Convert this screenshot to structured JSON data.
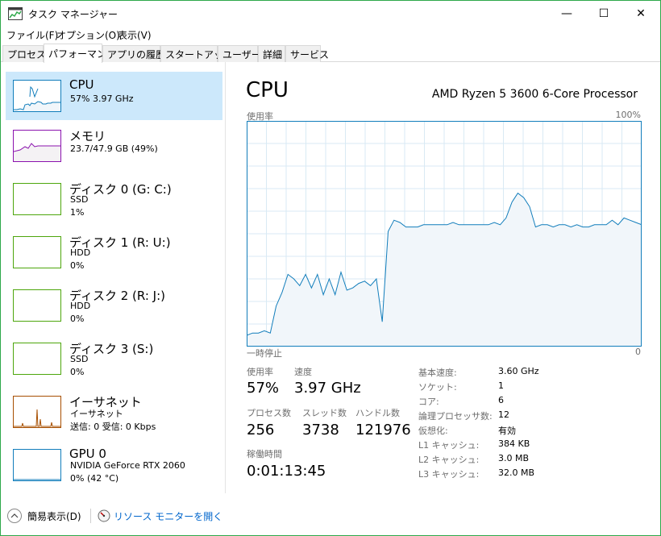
{
  "window": {
    "title": "タスク マネージャー",
    "minimize": "—",
    "maximize": "☐",
    "close": "✕"
  },
  "menu": [
    "ファイル(F)",
    "オプション(O)",
    "表示(V)"
  ],
  "tabs": [
    "プロセス",
    "パフォーマンス",
    "アプリの履歴",
    "スタートアップ",
    "ユーザー",
    "詳細",
    "サービス"
  ],
  "active_tab": "パフォーマンス",
  "devices": [
    {
      "title": "CPU",
      "lines": [
        "57%  3.97 GHz"
      ],
      "color": "#117dbb",
      "fill": "#f1f6fa",
      "selected": true
    },
    {
      "title": "メモリ",
      "lines": [
        "23.7/47.9 GB (49%)"
      ],
      "color": "#8b12ae",
      "fill": "#f4f2f4",
      "selected": false
    },
    {
      "title": "ディスク 0 (G: C:)",
      "lines": [
        "SSD",
        "1%"
      ],
      "color": "#4da60c",
      "fill": "#ffffff",
      "selected": false
    },
    {
      "title": "ディスク 1 (R: U:)",
      "lines": [
        "HDD",
        "0%"
      ],
      "color": "#4da60c",
      "fill": "#ffffff",
      "selected": false
    },
    {
      "title": "ディスク 2 (R: J:)",
      "lines": [
        "HDD",
        "0%"
      ],
      "color": "#4da60c",
      "fill": "#ffffff",
      "selected": false
    },
    {
      "title": "ディスク 3 (S:)",
      "lines": [
        "SSD",
        "0%"
      ],
      "color": "#4da60c",
      "fill": "#ffffff",
      "selected": false
    },
    {
      "title": "イーサネット",
      "lines": [
        "イーサネット",
        "送信: 0  受信: 0 Kbps"
      ],
      "color": "#a74f01",
      "fill": "#fcf3eb",
      "selected": false
    },
    {
      "title": "GPU 0",
      "lines": [
        "NVIDIA GeForce RTX 2060",
        "0%  (42 °C)"
      ],
      "color": "#117dbb",
      "fill": "#f1f6fa",
      "selected": false
    }
  ],
  "cpu": {
    "heading": "CPU",
    "model": "AMD Ryzen 5 3600 6-Core Processor",
    "graph_label": "使用率",
    "graph_max": "100%",
    "time_label": "一時停止",
    "time_zero": "0",
    "usage_label": "使用率",
    "usage_value": "57%",
    "speed_label": "速度",
    "speed_value": "3.97 GHz",
    "processes_label": "プロセス数",
    "processes_value": "256",
    "threads_label": "スレッド数",
    "threads_value": "3738",
    "handles_label": "ハンドル数",
    "handles_value": "121976",
    "uptime_label": "稼働時間",
    "uptime_value": "0:01:13:45",
    "specs": [
      {
        "k": "基本速度:",
        "v": "3.60 GHz"
      },
      {
        "k": "ソケット:",
        "v": "1"
      },
      {
        "k": "コア:",
        "v": "6"
      },
      {
        "k": "論理プロセッサ数:",
        "v": "12"
      },
      {
        "k": "仮想化:",
        "v": "有効"
      },
      {
        "k": "L1 キャッシュ:",
        "v": "384 KB"
      },
      {
        "k": "L2 キャッシュ:",
        "v": "3.0 MB"
      },
      {
        "k": "L3 キャッシュ:",
        "v": "32.0 MB"
      }
    ],
    "history": [
      5,
      6,
      6,
      7,
      6,
      18,
      24,
      32,
      30,
      27,
      32,
      26,
      32,
      23,
      30,
      23,
      33,
      25,
      26,
      28,
      29,
      27,
      30,
      11,
      51,
      56,
      55,
      53,
      53,
      53,
      54,
      54,
      54,
      54,
      54,
      55,
      54,
      54,
      54,
      54,
      54,
      54,
      55,
      54,
      57,
      64,
      68,
      66,
      62,
      53,
      54,
      54,
      53,
      54,
      54,
      53,
      54,
      53,
      53,
      54,
      54,
      54,
      56,
      54,
      57,
      56,
      55,
      54
    ]
  },
  "colors": {
    "accent": "#117dbb",
    "graph_fill": "#f1f6fa",
    "grid": "#d9eaf4",
    "selected_bg": "#cce8fb",
    "link": "#0066cc",
    "window_border": "#2ea84a"
  },
  "bottom": {
    "fewer_details": "簡易表示(D)",
    "resource_monitor": "リソース モニターを開く"
  },
  "icons": {
    "fewer": "chevron-up-circle-icon",
    "resmon": "resource-monitor-icon"
  }
}
